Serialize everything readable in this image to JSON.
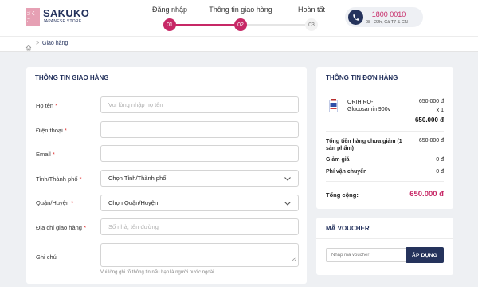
{
  "brand": {
    "logo_mark": "さくこ",
    "name": "SAKUKO",
    "tagline": "JAPANESE STORE"
  },
  "steps": [
    {
      "label": "Đăng nhập",
      "number": "01",
      "state": "active"
    },
    {
      "label": "Thông tin giao hàng",
      "number": "02",
      "state": "active"
    },
    {
      "label": "Hoàn tất",
      "number": "03",
      "state": "idle"
    }
  ],
  "hotline": {
    "number": "1800 0010",
    "hours": "08 - 22h, Cả T7 & CN"
  },
  "breadcrumb": {
    "home_icon": "home-icon",
    "current": "Giao hàng"
  },
  "shipping": {
    "title": "THÔNG TIN GIAO HÀNG",
    "fields": [
      {
        "label": "Họ tên",
        "required": true,
        "placeholder": "Vui lòng nhập họ tên",
        "value": ""
      },
      {
        "label": "Điện thoại",
        "required": true,
        "placeholder": "",
        "value": ""
      },
      {
        "label": "Email",
        "required": true,
        "placeholder": "",
        "value": ""
      },
      {
        "label": "Tỉnh/Thành phố",
        "required": true,
        "selected": "Chọn Tỉnh/Thành phố"
      },
      {
        "label": "Quận/Huyện",
        "required": true,
        "selected": "Chọn Quận/Huyện"
      },
      {
        "label": "Địa chỉ giao hàng",
        "required": true,
        "placeholder": "Số nhà, tên đường",
        "value": ""
      },
      {
        "label": "Ghi chú",
        "required": false,
        "value": ""
      }
    ],
    "note_hint": "Vui lòng ghi rõ thông tin nếu bạn là người nước ngoài"
  },
  "order": {
    "title": "THÔNG TIN ĐƠN HÀNG",
    "item": {
      "name": "ORIHIRO-Glucosamin 900v",
      "unit_price": "650.000 đ",
      "quantity": "x 1",
      "line_total": "650.000 đ"
    },
    "subtotal_label": "Tổng tiền hàng chưa giảm (1 sản phẩm)",
    "subtotal_value": "650.000 đ",
    "discount_label": "Giảm giá",
    "discount_value": "0 đ",
    "shipping_label": "Phí vận chuyển",
    "shipping_value": "0 đ",
    "total_label": "Tổng cộng:",
    "total_value": "650.000 đ"
  },
  "voucher": {
    "title": "MÃ VOUCHER",
    "placeholder": "Nhập mã voucher",
    "button": "ÁP DỤNG"
  },
  "colors": {
    "brand_navy": "#23315c",
    "accent_pink": "#c72866",
    "logo_pink": "#e6a0b4"
  }
}
